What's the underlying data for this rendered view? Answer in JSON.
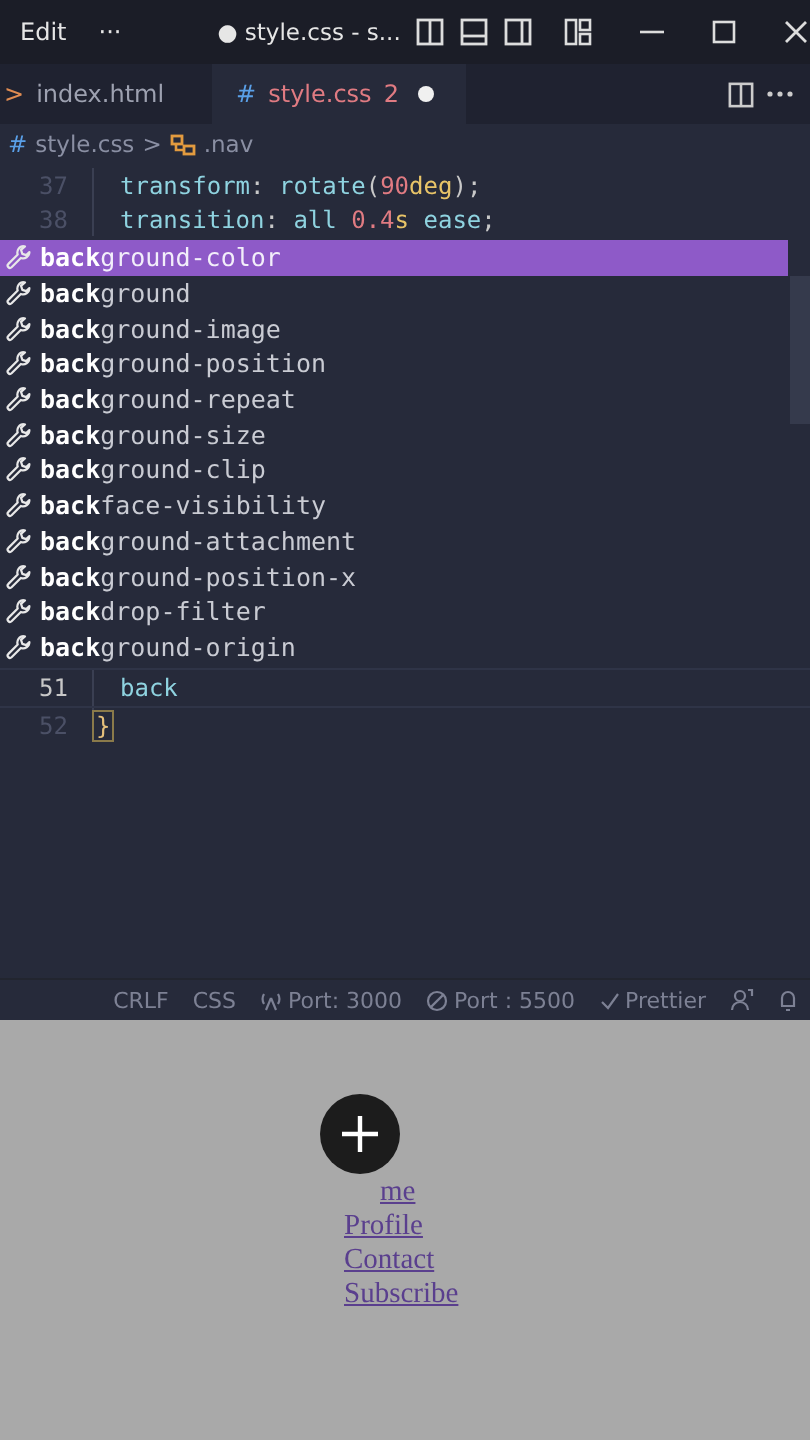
{
  "titlebar": {
    "menu": [
      "Edit",
      "···"
    ],
    "title": "● style.css - s..."
  },
  "tabs": [
    {
      "icon": ">",
      "label": "index.html",
      "selected": false,
      "modified": false
    },
    {
      "icon": "#",
      "label": "style.css",
      "badge": "2",
      "selected": true,
      "modified": true
    }
  ],
  "breadcrumb": {
    "icon": "#",
    "file": "style.css",
    "separator": ">",
    "symbol": ".nav"
  },
  "code_lines": [
    {
      "number": "37",
      "tokens": [
        {
          "kind": "prop",
          "text": "transform"
        },
        {
          "kind": "punct",
          "text": ": "
        },
        {
          "kind": "fn",
          "text": "rotate"
        },
        {
          "kind": "punct",
          "text": "("
        },
        {
          "kind": "num",
          "text": "90"
        },
        {
          "kind": "unit",
          "text": "deg"
        },
        {
          "kind": "punct",
          "text": ");"
        }
      ]
    },
    {
      "number": "38",
      "tokens": [
        {
          "kind": "prop",
          "text": "transition"
        },
        {
          "kind": "punct",
          "text": ": "
        },
        {
          "kind": "value",
          "text": "all "
        },
        {
          "kind": "num",
          "text": "0.4"
        },
        {
          "kind": "unit",
          "text": "s"
        },
        {
          "kind": "value",
          "text": " ease"
        },
        {
          "kind": "punct",
          "text": ";"
        }
      ]
    }
  ],
  "suggestions": [
    {
      "text": "**back**ground-color",
      "selected": true
    },
    {
      "text": "**back**ground",
      "selected": false
    },
    {
      "text": "**back**ground-image",
      "selected": false
    },
    {
      "text": "**back**ground-position",
      "selected": false
    },
    {
      "text": "**back**ground-repeat",
      "selected": false
    },
    {
      "text": "**back**ground-size",
      "selected": false
    },
    {
      "text": "**back**ground-clip",
      "selected": false
    },
    {
      "text": "**back**face-visibility",
      "selected": false
    },
    {
      "text": "**back**ground-attachment",
      "selected": false
    },
    {
      "text": "**back**ground-position-x",
      "selected": false
    },
    {
      "text": "**back**drop-filter",
      "selected": false
    },
    {
      "text": "**back**ground-origin",
      "selected": false
    }
  ],
  "after_lines": [
    {
      "number": "51",
      "text": "back",
      "kind": "value",
      "current": true
    },
    {
      "number": "52",
      "text": "}",
      "kind": "brace",
      "current": false
    }
  ],
  "status_bar": [
    {
      "kind": "text",
      "label": "CRLF"
    },
    {
      "kind": "text",
      "label": "CSS"
    },
    {
      "kind": "live",
      "label": "Port: 3000"
    },
    {
      "kind": "blocked",
      "label": "Port : 5500"
    },
    {
      "kind": "check",
      "label": "Prettier"
    },
    {
      "kind": "feedback"
    },
    {
      "kind": "bell"
    }
  ],
  "preview": {
    "links": [
      "me",
      "Profile",
      "Contact",
      "Subscribe"
    ]
  }
}
